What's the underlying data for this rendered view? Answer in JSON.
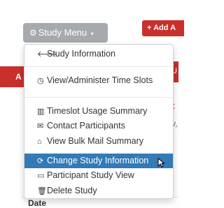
{
  "toolbar": {
    "study_menu_label": "Study Menu",
    "add_label": "Add A"
  },
  "background": {
    "left_banner_text": "A",
    "right_banner_text": "U",
    "fragment_t": "t",
    "fragment_v": "v,",
    "date_header": "Date"
  },
  "menu": {
    "items": [
      {
        "label": "Study Information",
        "icon": "arrow-left-icon"
      },
      {
        "label": "View/Administer Time Slots",
        "icon": "clock-icon"
      },
      {
        "label": "Timeslot Usage Summary",
        "icon": "bar-chart-icon"
      },
      {
        "label": "Contact Participants",
        "icon": "envelope-icon"
      },
      {
        "label": "View Bulk Mail Summary",
        "icon": "inbox-icon"
      },
      {
        "label": "Change Study Information",
        "icon": "refresh-icon",
        "active": true
      },
      {
        "label": "Participant Study View",
        "icon": "laptop-icon"
      },
      {
        "label": "Delete Study",
        "icon": "trash-icon"
      }
    ]
  },
  "colors": {
    "primary": "#337ab7",
    "danger": "#c9302c",
    "button_gray": "#a6aaae"
  }
}
